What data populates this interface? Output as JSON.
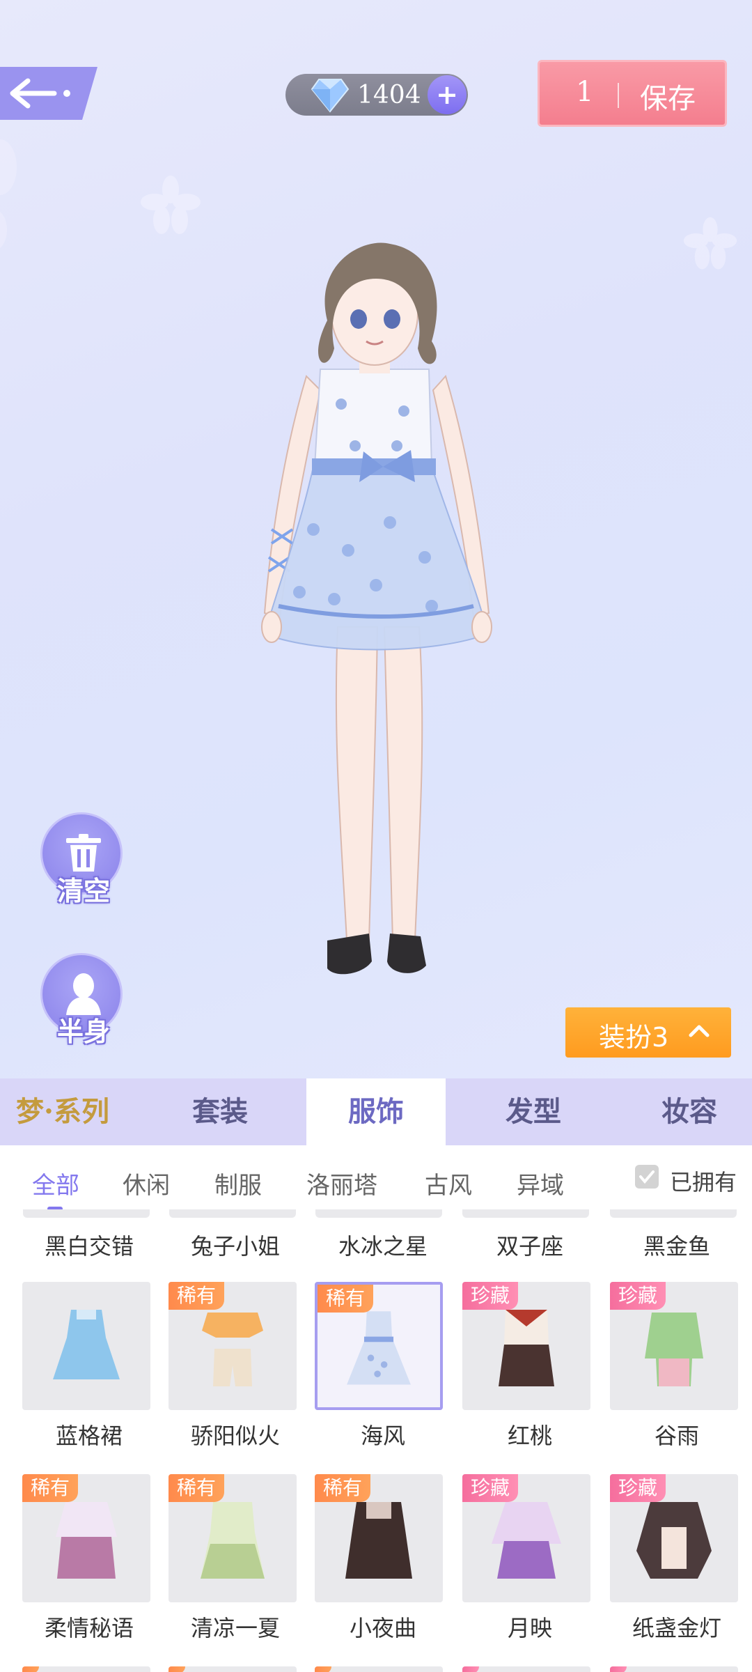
{
  "header": {
    "gems": "1404",
    "save": {
      "count": "1",
      "label": "保存"
    }
  },
  "side": {
    "clear": "清空",
    "half_body": "半身"
  },
  "outfit_button": "装扮3",
  "category_tabs": [
    "梦·系列",
    "套装",
    "服饰",
    "发型",
    "妆容"
  ],
  "active_category": "服饰",
  "sub_tabs": [
    "全部",
    "休闲",
    "制服",
    "洛丽塔",
    "古风",
    "异域"
  ],
  "owned_filter": "已拥有",
  "top_row_names": [
    "黑白交错",
    "兔子小姐",
    "水冰之星",
    "双子座",
    "黑金鱼"
  ],
  "items_row1": [
    {
      "name": "蓝格裙",
      "badge": ""
    },
    {
      "name": "骄阳似火",
      "badge": "稀有"
    },
    {
      "name": "海风",
      "badge": "稀有"
    },
    {
      "name": "红桃",
      "badge": "珍藏"
    },
    {
      "name": "谷雨",
      "badge": "珍藏"
    }
  ],
  "items_row2": [
    {
      "name": "柔情秘语",
      "badge": "稀有"
    },
    {
      "name": "清凉一夏",
      "badge": "稀有"
    },
    {
      "name": "小夜曲",
      "badge": "稀有"
    },
    {
      "name": "月映",
      "badge": "珍藏"
    },
    {
      "name": "纸盏金灯",
      "badge": "珍藏"
    }
  ],
  "colors": {
    "accent": "#8378ee",
    "save": "#f47e8e",
    "outfit": "#ff9b1f",
    "rare": "#ff8a4c",
    "treasure": "#f56e9d"
  }
}
